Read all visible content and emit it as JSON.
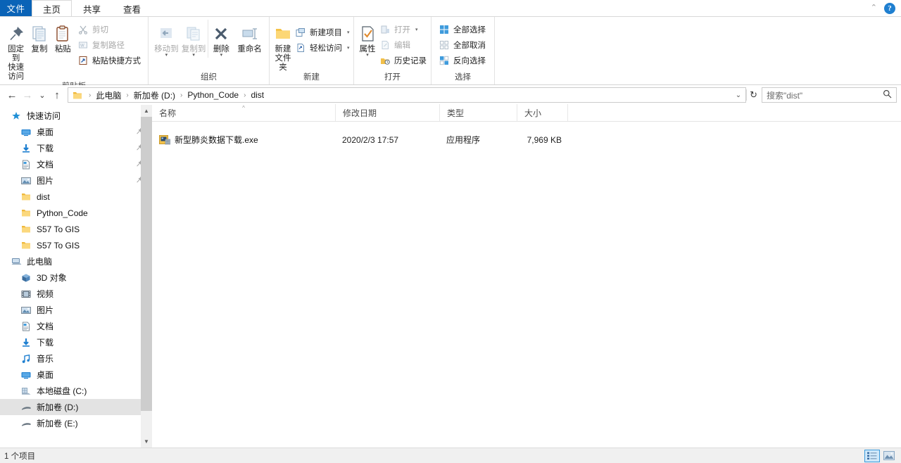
{
  "window": {
    "tabs": [
      {
        "label": "文件",
        "name": "tab-file",
        "active": false
      },
      {
        "label": "主页",
        "name": "tab-home",
        "active": true
      },
      {
        "label": "共享",
        "name": "tab-share",
        "active": false
      },
      {
        "label": "查看",
        "name": "tab-view",
        "active": false
      }
    ],
    "collapse_ribbon_icon": "chevron-up-icon",
    "help_label": "?"
  },
  "ribbon": {
    "groups": [
      {
        "title": "剪贴板",
        "big_buttons": [
          {
            "label": "固定到\n快速访问",
            "icon": "pin-icon"
          },
          {
            "label": "复制",
            "icon": "copy-icon"
          },
          {
            "label": "粘贴",
            "icon": "paste-icon"
          }
        ],
        "small_buttons": [
          {
            "label": "剪切",
            "icon": "scissors-icon",
            "dim": true
          },
          {
            "label": "复制路径",
            "icon": "copy-path-icon",
            "dim": true
          },
          {
            "label": "粘贴快捷方式",
            "icon": "paste-shortcut-icon",
            "dim": false
          }
        ]
      },
      {
        "title": "组织",
        "big_buttons": [
          {
            "label": "移动到",
            "icon": "move-to-icon",
            "caret": true,
            "dim": true
          },
          {
            "label": "复制到",
            "icon": "copy-to-icon",
            "caret": true,
            "dim": true
          },
          {
            "label": "删除",
            "icon": "delete-icon",
            "caret": true
          },
          {
            "label": "重命名",
            "icon": "rename-icon"
          }
        ]
      },
      {
        "title": "新建",
        "big_buttons": [
          {
            "label": "新建\n文件夹",
            "icon": "new-folder-icon"
          }
        ],
        "small_buttons": [
          {
            "label": "新建项目",
            "icon": "new-item-icon",
            "caret": true
          },
          {
            "label": "轻松访问",
            "icon": "easy-access-icon",
            "caret": true
          }
        ]
      },
      {
        "title": "打开",
        "big_buttons": [
          {
            "label": "属性",
            "icon": "properties-icon",
            "caret": true
          }
        ],
        "small_buttons": [
          {
            "label": "打开",
            "icon": "open-icon",
            "caret": true,
            "dim": true
          },
          {
            "label": "编辑",
            "icon": "edit-icon",
            "dim": true
          },
          {
            "label": "历史记录",
            "icon": "history-icon"
          }
        ]
      },
      {
        "title": "选择",
        "small_buttons": [
          {
            "label": "全部选择",
            "icon": "select-all-icon"
          },
          {
            "label": "全部取消",
            "icon": "select-none-icon"
          },
          {
            "label": "反向选择",
            "icon": "invert-selection-icon"
          }
        ]
      }
    ]
  },
  "address": {
    "back_icon": "arrow-left-icon",
    "forward_icon": "arrow-right-icon",
    "recent_icon": "chevron-down-icon",
    "up_icon": "arrow-up-icon",
    "folder_icon": "folder-icon",
    "breadcrumbs": [
      "此电脑",
      "新加卷 (D:)",
      "Python_Code",
      "dist"
    ],
    "separator": "›",
    "dropdown_icon": "chevron-down-icon",
    "refresh_icon": "refresh-icon"
  },
  "search": {
    "placeholder": "搜索\"dist\"",
    "icon": "search-icon"
  },
  "sidebar": {
    "scroll": {
      "up_icon": "chevron-up-icon",
      "down_icon": "chevron-down-icon"
    },
    "items": [
      {
        "label": "快速访问",
        "icon": "star-icon",
        "level": "root",
        "pinned": false,
        "selected": false
      },
      {
        "label": "桌面",
        "icon": "desktop-icon",
        "level": "child",
        "pinned": true,
        "selected": false
      },
      {
        "label": "下载",
        "icon": "download-icon",
        "level": "child",
        "pinned": true,
        "selected": false
      },
      {
        "label": "文档",
        "icon": "document-icon",
        "level": "child",
        "pinned": true,
        "selected": false
      },
      {
        "label": "图片",
        "icon": "pictures-icon",
        "level": "child",
        "pinned": true,
        "selected": false
      },
      {
        "label": "dist",
        "icon": "folder-icon",
        "level": "child",
        "pinned": false,
        "selected": false
      },
      {
        "label": "Python_Code",
        "icon": "folder-icon",
        "level": "child",
        "pinned": false,
        "selected": false
      },
      {
        "label": "S57 To GIS",
        "icon": "folder-icon",
        "level": "child",
        "pinned": false,
        "selected": false
      },
      {
        "label": "S57 To GIS",
        "icon": "folder-icon",
        "level": "child",
        "pinned": false,
        "selected": false
      },
      {
        "label": "此电脑",
        "icon": "this-pc-icon",
        "level": "root",
        "pinned": false,
        "selected": false
      },
      {
        "label": "3D 对象",
        "icon": "3d-objects-icon",
        "level": "child",
        "pinned": false,
        "selected": false
      },
      {
        "label": "视频",
        "icon": "videos-icon",
        "level": "child",
        "pinned": false,
        "selected": false
      },
      {
        "label": "图片",
        "icon": "pictures-icon",
        "level": "child",
        "pinned": false,
        "selected": false
      },
      {
        "label": "文档",
        "icon": "document-icon",
        "level": "child",
        "pinned": false,
        "selected": false
      },
      {
        "label": "下载",
        "icon": "download-icon",
        "level": "child",
        "pinned": false,
        "selected": false
      },
      {
        "label": "音乐",
        "icon": "music-icon",
        "level": "child",
        "pinned": false,
        "selected": false
      },
      {
        "label": "桌面",
        "icon": "desktop-icon",
        "level": "child",
        "pinned": false,
        "selected": false
      },
      {
        "label": "本地磁盘 (C:)",
        "icon": "local-disk-icon",
        "level": "child",
        "pinned": false,
        "selected": false
      },
      {
        "label": "新加卷 (D:)",
        "icon": "drive-icon",
        "level": "child",
        "pinned": false,
        "selected": true
      },
      {
        "label": "新加卷 (E:)",
        "icon": "drive-icon",
        "level": "child",
        "pinned": false,
        "selected": false
      }
    ]
  },
  "filelist": {
    "columns": [
      {
        "label": "名称",
        "key": "name"
      },
      {
        "label": "修改日期",
        "key": "date"
      },
      {
        "label": "类型",
        "key": "type"
      },
      {
        "label": "大小",
        "key": "size"
      }
    ],
    "sort_indicator": "^",
    "rows": [
      {
        "name": "新型肺炎数据下载.exe",
        "date": "2020/2/3 17:57",
        "type": "应用程序",
        "size": "7,969 KB",
        "icon": "exe-app-icon"
      }
    ]
  },
  "statusbar": {
    "item_count": "1 个项目",
    "views": [
      {
        "name": "details-view-button",
        "icon": "details-view-icon",
        "active": true
      },
      {
        "name": "large-icons-view-button",
        "icon": "large-icons-view-icon",
        "active": false
      }
    ]
  },
  "colors": {
    "accent": "#0a63b7",
    "selection": "#e3e3e3",
    "folder": "#f7c75e",
    "help": "#1f7fd0"
  }
}
